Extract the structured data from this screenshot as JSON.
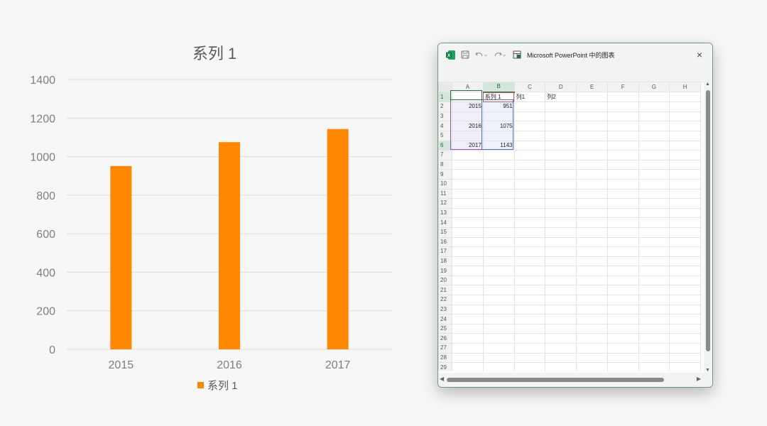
{
  "chart_data": {
    "type": "bar",
    "title": "系列 1",
    "categories": [
      "2015",
      "2016",
      "2017"
    ],
    "series": [
      {
        "name": "系列 1",
        "values": [
          951,
          1075,
          1143
        ],
        "color": "#ff8800"
      }
    ],
    "ylim": [
      0,
      1400
    ],
    "yticks": [
      "0",
      "200",
      "400",
      "600",
      "800",
      "1000",
      "1200",
      "1400"
    ],
    "grid": true,
    "legend": "bottom"
  },
  "excel": {
    "title": "Microsoft PowerPoint 中的图表",
    "close": "×",
    "columns": [
      "A",
      "B",
      "C",
      "D",
      "E",
      "F",
      "G",
      "H"
    ],
    "rows": [
      [
        "",
        "系列 1",
        "列1",
        "列2",
        "",
        "",
        "",
        ""
      ],
      [
        "2015",
        "951",
        "",
        "",
        "",
        "",
        "",
        ""
      ],
      [
        "",
        "",
        "",
        "",
        "",
        "",
        "",
        ""
      ],
      [
        "2016",
        "1075",
        "",
        "",
        "",
        "",
        "",
        ""
      ],
      [
        "",
        "",
        "",
        "",
        "",
        "",
        "",
        ""
      ],
      [
        "2017",
        "1143",
        "",
        "",
        "",
        "",
        "",
        ""
      ]
    ],
    "row_count": 29,
    "icons": [
      "excel-icon",
      "save-icon",
      "undo-icon",
      "redo-icon",
      "table-icon"
    ],
    "accent": "#217346"
  }
}
